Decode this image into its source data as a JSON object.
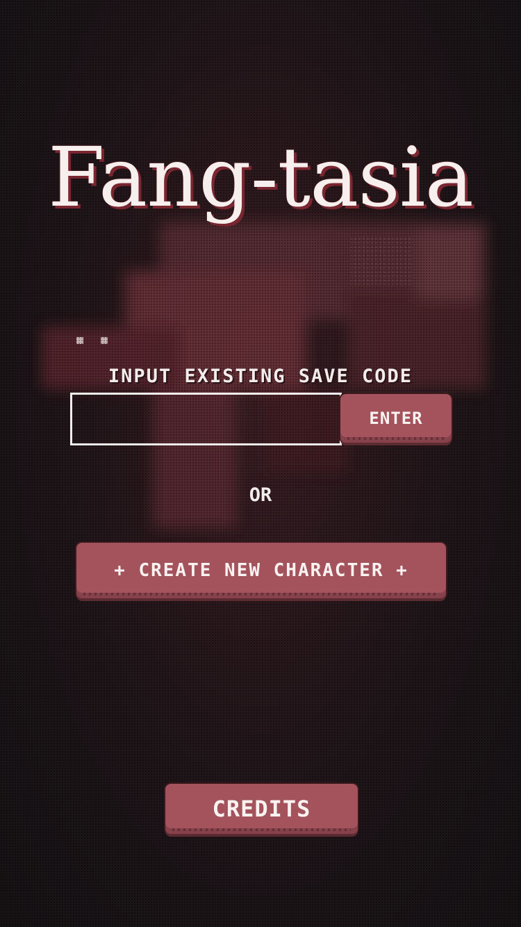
{
  "game": {
    "title": "Fang-tasia"
  },
  "save_code": {
    "label": "INPUT EXISTING SAVE CODE",
    "value": "",
    "placeholder": "",
    "enter_label": "ENTER"
  },
  "divider": {
    "or_label": "OR"
  },
  "actions": {
    "create_label": "+ CREATE NEW CHARACTER +",
    "credits_label": "CREDITS"
  },
  "colors": {
    "background": "#1c1518",
    "accent_button": "#a4525c",
    "title_text": "#f7eeee",
    "title_shadow": "#7a2630"
  }
}
